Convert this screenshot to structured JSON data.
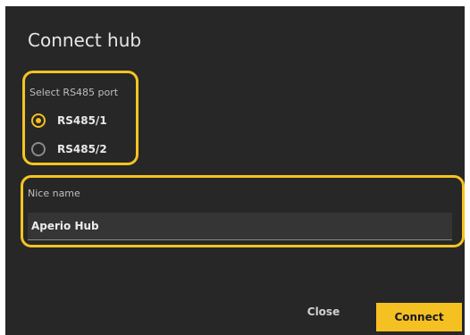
{
  "dialog": {
    "title": "Connect hub"
  },
  "port_select": {
    "label": "Select RS485 port",
    "options": [
      {
        "label": "RS485/1",
        "selected": true
      },
      {
        "label": "RS485/2",
        "selected": false
      }
    ]
  },
  "nice_name": {
    "label": "Nice name",
    "value": "Aperio Hub"
  },
  "actions": {
    "close_label": "Close",
    "connect_label": "Connect"
  },
  "colors": {
    "accent": "#f5c022",
    "dialog_bg": "#272727",
    "field_bg": "#353535"
  }
}
